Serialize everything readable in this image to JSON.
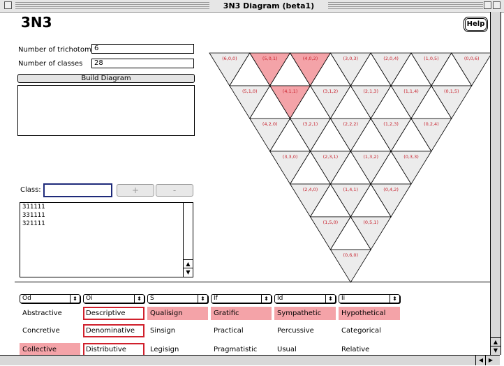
{
  "window": {
    "title": "3N3 Diagram (beta1)"
  },
  "app": {
    "heading": "3N3",
    "help_label": "Help"
  },
  "form": {
    "trichotomies_label": "Number of trichotomies",
    "trichotomies_value": "6",
    "classes_label": "Number of classes",
    "classes_value": "28",
    "build_label": "Build Diagram",
    "class_label": "Class:",
    "class_value": "",
    "plus_label": "+",
    "minus_label": "-"
  },
  "class_list": [
    "311111",
    "331111",
    "321111"
  ],
  "diagram": {
    "highlight_color": "#f4a3a8",
    "label_color": "#c8202c",
    "rows": [
      [
        "(6,0,0)",
        "(5,0,1)",
        "(4,0,2)",
        "(3,0,3)",
        "(2,0,4)",
        "(1,0,5)",
        "(0,0,6)"
      ],
      [
        "(5,1,0)",
        "(4,1,1)",
        "(3,1,2)",
        "(2,1,3)",
        "(1,1,4)",
        "(0,1,5)"
      ],
      [
        "(4,2,0)",
        "(3,2,1)",
        "(2,2,2)",
        "(1,2,3)",
        "(0,2,4)"
      ],
      [
        "(3,3,0)",
        "(2,3,1)",
        "(1,3,2)",
        "(0,3,3)"
      ],
      [
        "(2,4,0)",
        "(1,4,1)",
        "(0,4,2)"
      ],
      [
        "(1,5,0)",
        "(0,5,1)"
      ],
      [
        "(0,6,0)"
      ]
    ],
    "highlighted": [
      "(5,0,1)",
      "(4,0,2)",
      "(4,1,1)"
    ]
  },
  "columns": [
    {
      "select": "Od",
      "cells": [
        {
          "text": "Abstractive",
          "style": ""
        },
        {
          "text": "Concretive",
          "style": ""
        },
        {
          "text": "Collective",
          "style": "pink"
        }
      ]
    },
    {
      "select": "Oi",
      "cells": [
        {
          "text": "Descriptive",
          "style": "red"
        },
        {
          "text": "Denominative",
          "style": "red"
        },
        {
          "text": "Distributive",
          "style": "red"
        }
      ]
    },
    {
      "select": "S",
      "cells": [
        {
          "text": "Qualisign",
          "style": "pink"
        },
        {
          "text": "Sinsign",
          "style": ""
        },
        {
          "text": "Legisign",
          "style": ""
        }
      ]
    },
    {
      "select": "If",
      "cells": [
        {
          "text": "Gratific",
          "style": "pink"
        },
        {
          "text": "Practical",
          "style": ""
        },
        {
          "text": "Pragmatistic",
          "style": ""
        }
      ]
    },
    {
      "select": "Id",
      "cells": [
        {
          "text": "Sympathetic",
          "style": "pink"
        },
        {
          "text": "Percussive",
          "style": ""
        },
        {
          "text": "Usual",
          "style": ""
        }
      ]
    },
    {
      "select": "Ii",
      "cells": [
        {
          "text": "Hypothetical",
          "style": "pink"
        },
        {
          "text": "Categorical",
          "style": ""
        },
        {
          "text": "Relative",
          "style": ""
        }
      ]
    }
  ]
}
